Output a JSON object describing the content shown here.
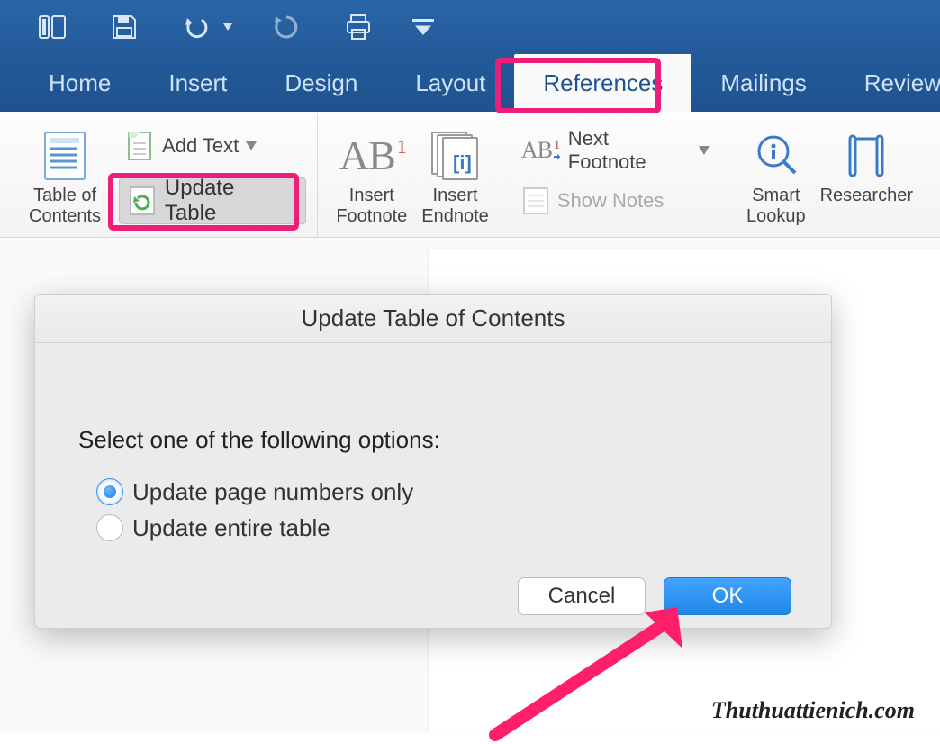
{
  "qat": {
    "items": [
      "page-panel-icon",
      "save-icon",
      "undo-icon",
      "repeat-icon",
      "print-icon",
      "customize-icon"
    ]
  },
  "tabs": {
    "items": [
      {
        "label": "Home",
        "active": false
      },
      {
        "label": "Insert",
        "active": false
      },
      {
        "label": "Design",
        "active": false
      },
      {
        "label": "Layout",
        "active": false
      },
      {
        "label": "References",
        "active": true,
        "highlighted": true
      },
      {
        "label": "Mailings",
        "active": false
      },
      {
        "label": "Review",
        "active": false
      }
    ]
  },
  "ribbon": {
    "toc": {
      "label": "Table of\nContents"
    },
    "add_text": {
      "label": "Add Text"
    },
    "update_table": {
      "label": "Update Table",
      "highlighted": true
    },
    "insert_footnote": {
      "label": "Insert\nFootnote",
      "glyph": "AB",
      "sup": "1"
    },
    "insert_endnote": {
      "label": "Insert\nEndnote"
    },
    "next_footnote": {
      "label": "Next Footnote",
      "glyph": "AB",
      "sup": "1"
    },
    "show_notes": {
      "label": "Show Notes",
      "disabled": true
    },
    "smart_lookup": {
      "label": "Smart\nLookup"
    },
    "researcher": {
      "label": "Researcher"
    }
  },
  "dialog": {
    "title": "Update Table of Contents",
    "prompt": "Select one of the following options:",
    "options": [
      {
        "label": "Update page numbers only",
        "checked": true
      },
      {
        "label": "Update entire table",
        "checked": false
      }
    ],
    "cancel": "Cancel",
    "ok": "OK"
  },
  "annotation": {
    "highlight_color": "#ed1e79",
    "arrow_color": "#ff1e6a"
  },
  "watermark": "Thuthuattienich.com"
}
